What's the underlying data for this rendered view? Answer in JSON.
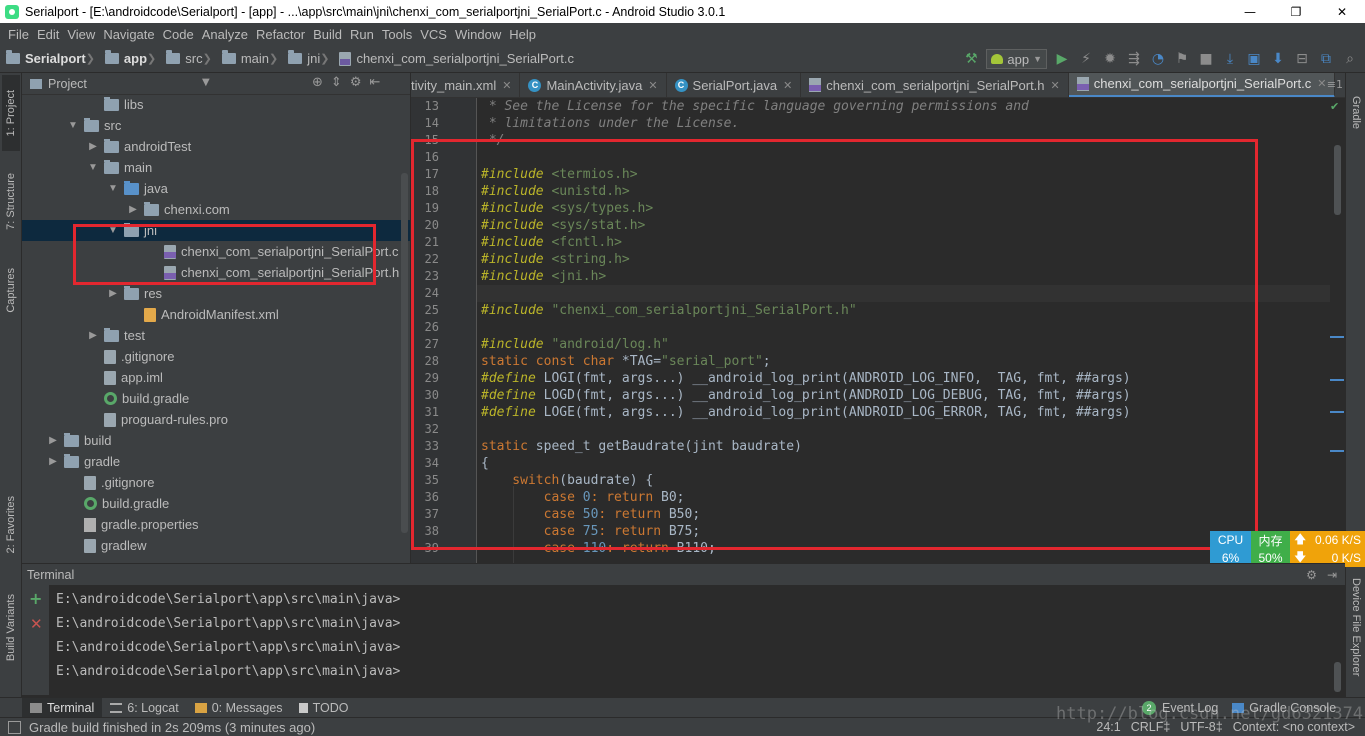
{
  "window": {
    "title": "Serialport - [E:\\androidcode\\Serialport] - [app] - ...\\app\\src\\main\\jni\\chenxi_com_serialportjni_SerialPort.c - Android Studio 3.0.1",
    "minimize": "—",
    "maximize": "❐",
    "close": "✕"
  },
  "menu": [
    "File",
    "Edit",
    "View",
    "Navigate",
    "Code",
    "Analyze",
    "Refactor",
    "Build",
    "Run",
    "Tools",
    "VCS",
    "Window",
    "Help"
  ],
  "breadcrumb": [
    "Serialport",
    "app",
    "src",
    "main",
    "jni",
    "chenxi_com_serialportjni_SerialPort.c"
  ],
  "toolbar": {
    "run_config": "app"
  },
  "left_tabs": [
    "1: Project",
    "7: Structure",
    "Captures",
    "2: Favorites",
    "Build Variants"
  ],
  "right_tabs": [
    "Gradle",
    "Device File Explorer"
  ],
  "project_panel": {
    "title": "Project",
    "tree": [
      {
        "label": "libs",
        "depth": 2,
        "arrow": "",
        "icon": "folder"
      },
      {
        "label": "src",
        "depth": 1,
        "arrow": "▼",
        "icon": "folder"
      },
      {
        "label": "androidTest",
        "depth": 2,
        "arrow": "▶",
        "icon": "folder"
      },
      {
        "label": "main",
        "depth": 2,
        "arrow": "▼",
        "icon": "folder"
      },
      {
        "label": "java",
        "depth": 3,
        "arrow": "▼",
        "icon": "folder-blue"
      },
      {
        "label": "chenxi.com",
        "depth": 4,
        "arrow": "▶",
        "icon": "folder-pkg"
      },
      {
        "label": "jni",
        "depth": 3,
        "arrow": "▼",
        "icon": "folder",
        "selected": true
      },
      {
        "label": "chenxi_com_serialportjni_SerialPort.c",
        "depth": 5,
        "arrow": "",
        "icon": "cfile"
      },
      {
        "label": "chenxi_com_serialportjni_SerialPort.h",
        "depth": 5,
        "arrow": "",
        "icon": "cfile"
      },
      {
        "label": "res",
        "depth": 3,
        "arrow": "▶",
        "icon": "folder"
      },
      {
        "label": "AndroidManifest.xml",
        "depth": 4,
        "arrow": "",
        "icon": "xml"
      },
      {
        "label": "test",
        "depth": 2,
        "arrow": "▶",
        "icon": "folder"
      },
      {
        "label": ".gitignore",
        "depth": 2,
        "arrow": "",
        "icon": "file"
      },
      {
        "label": "app.iml",
        "depth": 2,
        "arrow": "",
        "icon": "file"
      },
      {
        "label": "build.gradle",
        "depth": 2,
        "arrow": "",
        "icon": "gradle"
      },
      {
        "label": "proguard-rules.pro",
        "depth": 2,
        "arrow": "",
        "icon": "file"
      },
      {
        "label": "build",
        "depth": 0,
        "arrow": "▶",
        "icon": "folder"
      },
      {
        "label": "gradle",
        "depth": 0,
        "arrow": "▶",
        "icon": "folder"
      },
      {
        "label": ".gitignore",
        "depth": 1,
        "arrow": "",
        "icon": "file"
      },
      {
        "label": "build.gradle",
        "depth": 1,
        "arrow": "",
        "icon": "gradle"
      },
      {
        "label": "gradle.properties",
        "depth": 1,
        "arrow": "",
        "icon": "props"
      },
      {
        "label": "gradlew",
        "depth": 1,
        "arrow": "",
        "icon": "file"
      }
    ]
  },
  "editor_tabs": [
    {
      "label": "tivity_main.xml",
      "badge": "",
      "active": false
    },
    {
      "label": "MainActivity.java",
      "badge": "C",
      "active": false
    },
    {
      "label": "SerialPort.java",
      "badge": "C",
      "active": false
    },
    {
      "label": "chenxi_com_serialportjni_SerialPort.h",
      "badge": "h",
      "active": false
    },
    {
      "label": "chenxi_com_serialportjni_SerialPort.c",
      "badge": "h",
      "active": true
    }
  ],
  "editor_tab_overflow": "≡1",
  "code": [
    {
      "n": "13",
      "t": " * See the License for the specific language governing permissions and",
      "k": "cm"
    },
    {
      "n": "14",
      "t": " * limitations under the License.",
      "k": "cm"
    },
    {
      "n": "15",
      "t": " */",
      "k": "cm"
    },
    {
      "n": "16",
      "t": "",
      "k": "plain"
    },
    {
      "n": "17",
      "a": "#include",
      "b": " <termios.h>",
      "k": "inc"
    },
    {
      "n": "18",
      "a": "#include",
      "b": " <unistd.h>",
      "k": "inc"
    },
    {
      "n": "19",
      "a": "#include",
      "b": " <sys/types.h>",
      "k": "inc"
    },
    {
      "n": "20",
      "a": "#include",
      "b": " <sys/stat.h>",
      "k": "inc"
    },
    {
      "n": "21",
      "a": "#include",
      "b": " <fcntl.h>",
      "k": "inc"
    },
    {
      "n": "22",
      "a": "#include",
      "b": " <string.h>",
      "k": "inc"
    },
    {
      "n": "23",
      "a": "#include",
      "b": " <jni.h>",
      "k": "inc"
    },
    {
      "n": "24",
      "t": "",
      "k": "current"
    },
    {
      "n": "25",
      "a": "#include",
      "b": " \"chenxi_com_serialportjni_SerialPort.h\"",
      "k": "incstr"
    },
    {
      "n": "26",
      "t": "",
      "k": "plain"
    },
    {
      "n": "27",
      "a": "#include",
      "b": " \"android/log.h\"",
      "k": "incstr"
    },
    {
      "n": "28",
      "a": "static const char",
      "b": " *TAG=",
      "c": "\"serial_port\"",
      "d": ";",
      "k": "decl"
    },
    {
      "n": "29",
      "a": "#define",
      "b": " LOGI(fmt, args...) __android_log_print(ANDROID_LOG_INFO,  TAG, fmt, ##args)",
      "k": "def"
    },
    {
      "n": "30",
      "a": "#define",
      "b": " LOGD(fmt, args...) __android_log_print(ANDROID_LOG_DEBUG, TAG, fmt, ##args)",
      "k": "def"
    },
    {
      "n": "31",
      "a": "#define",
      "b": " LOGE(fmt, args...) __android_log_print(ANDROID_LOG_ERROR, TAG, fmt, ##args)",
      "k": "def"
    },
    {
      "n": "32",
      "t": "",
      "k": "plain"
    },
    {
      "n": "33",
      "a": "static",
      "b": " speed_t getBaudrate(jint baudrate)",
      "k": "kwline"
    },
    {
      "n": "34",
      "t": "{",
      "k": "plain"
    },
    {
      "n": "35",
      "a": "    switch",
      "b": "(baudrate) {",
      "k": "kwline"
    },
    {
      "n": "36",
      "a": "        case ",
      "n1": "0",
      "c": ": return",
      "d": " B0;",
      "k": "case"
    },
    {
      "n": "37",
      "a": "        case ",
      "n1": "50",
      "c": ": return",
      "d": " B50;",
      "k": "case"
    },
    {
      "n": "38",
      "a": "        case ",
      "n1": "75",
      "c": ": return",
      "d": " B75;",
      "k": "case"
    },
    {
      "n": "39",
      "a": "        case ",
      "n1": "110",
      "c": ": return",
      "d": " B110;",
      "k": "case"
    }
  ],
  "perf": {
    "cpu_label": "CPU",
    "cpu_value": "6%",
    "mem_label": "内存",
    "mem_value": "50%",
    "up": "0.06 K/S",
    "down": "0 K/S",
    "up_arrow": "🡅",
    "down_arrow": "🡇"
  },
  "terminal": {
    "title": "Terminal",
    "lines": [
      "E:\\androidcode\\Serialport\\app\\src\\main\\java>",
      "E:\\androidcode\\Serialport\\app\\src\\main\\java>",
      "E:\\androidcode\\Serialport\\app\\src\\main\\java>",
      "E:\\androidcode\\Serialport\\app\\src\\main\\java>"
    ]
  },
  "bottom_tabs": [
    {
      "label": "Terminal",
      "active": true
    },
    {
      "label": "6: Logcat",
      "active": false
    },
    {
      "label": "0: Messages",
      "active": false
    },
    {
      "label": "TODO",
      "active": false
    }
  ],
  "bottom_right_tabs": [
    {
      "label": "Event Log",
      "badge": "2"
    },
    {
      "label": "Gradle Console"
    }
  ],
  "status": {
    "message": "Gradle build finished in 2s 209ms (3 minutes ago)",
    "position": "24:1",
    "line_sep": "CRLF‡",
    "encoding": "UTF-8‡",
    "context": "Context: <no context>"
  },
  "watermark": "http://blog.csdn.net/gd6321374",
  "colors": {
    "accent": "#4a88c7",
    "annotation_red": "#e3272f",
    "cpu_bg": "#2f9bd3",
    "mem_bg": "#3fae49",
    "net_bg": "#f0a30a"
  }
}
